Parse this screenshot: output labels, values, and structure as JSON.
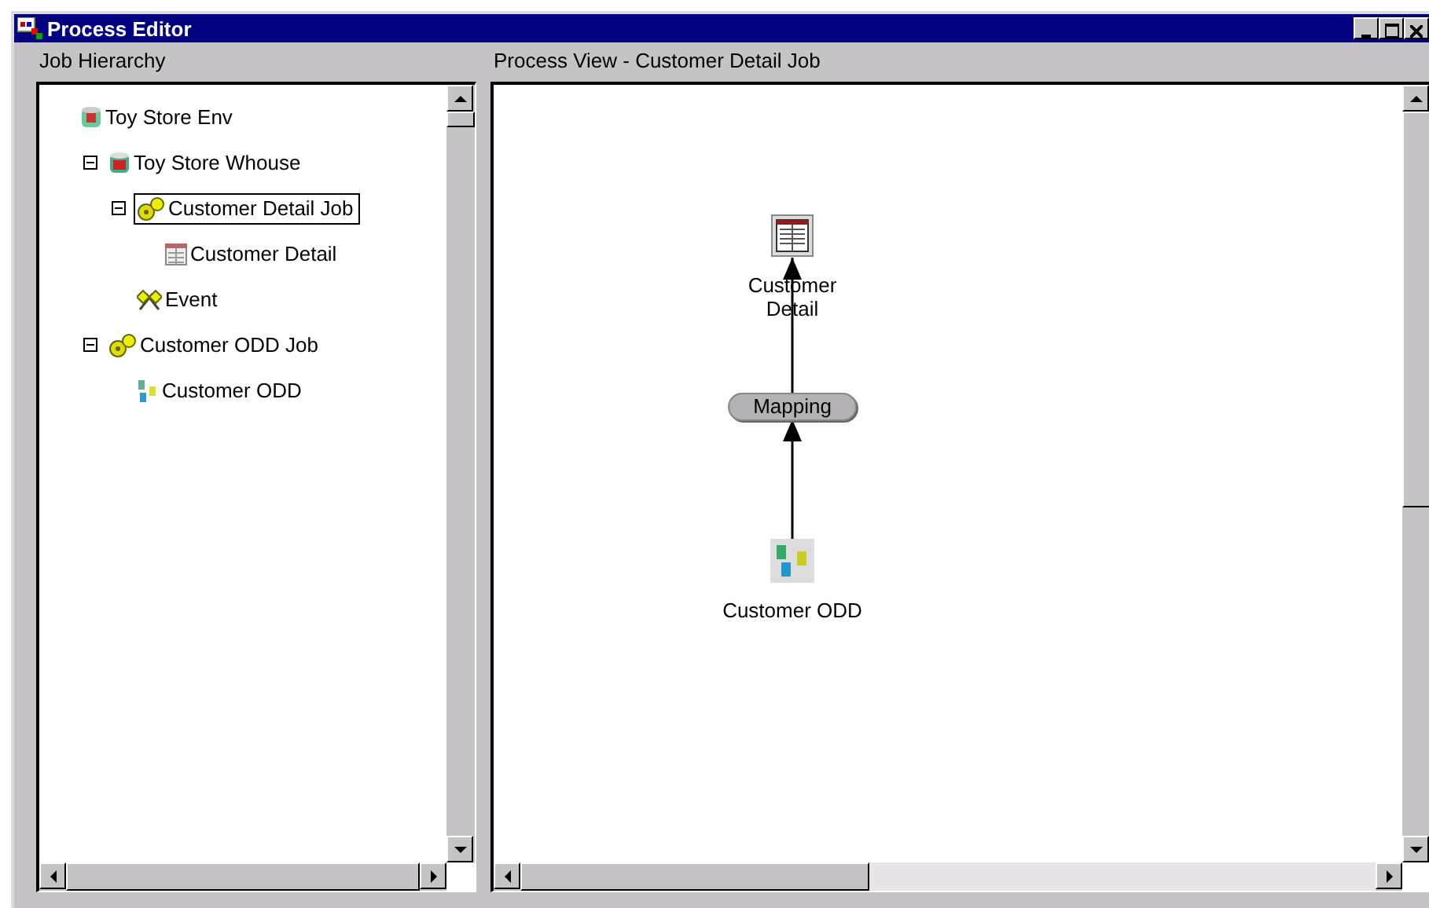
{
  "window": {
    "title": "Process Editor"
  },
  "job_hierarchy": {
    "label": "Job Hierarchy",
    "tree": [
      {
        "label": "Toy Store Env",
        "kind": "env",
        "selected": false,
        "children": [
          {
            "label": "Toy Store Whouse",
            "kind": "warehouse",
            "expanded": true,
            "selected": false,
            "children": [
              {
                "label": "Customer Detail Job",
                "kind": "job",
                "expanded": true,
                "selected": true,
                "children": [
                  {
                    "label": "Customer Detail",
                    "kind": "table",
                    "selected": false
                  }
                ]
              },
              {
                "label": "Event",
                "kind": "event",
                "selected": false
              }
            ]
          },
          {
            "label": "Customer ODD Job",
            "kind": "job",
            "expanded": true,
            "selected": false,
            "children": [
              {
                "label": "Customer ODD",
                "kind": "source",
                "selected": false
              }
            ]
          }
        ]
      }
    ]
  },
  "process_view": {
    "label": "Process View - Customer Detail Job",
    "nodes": [
      {
        "kind": "table",
        "label": "Customer Detail"
      },
      {
        "kind": "mapping",
        "label": "Mapping"
      },
      {
        "kind": "source",
        "label": "Customer ODD"
      }
    ]
  }
}
